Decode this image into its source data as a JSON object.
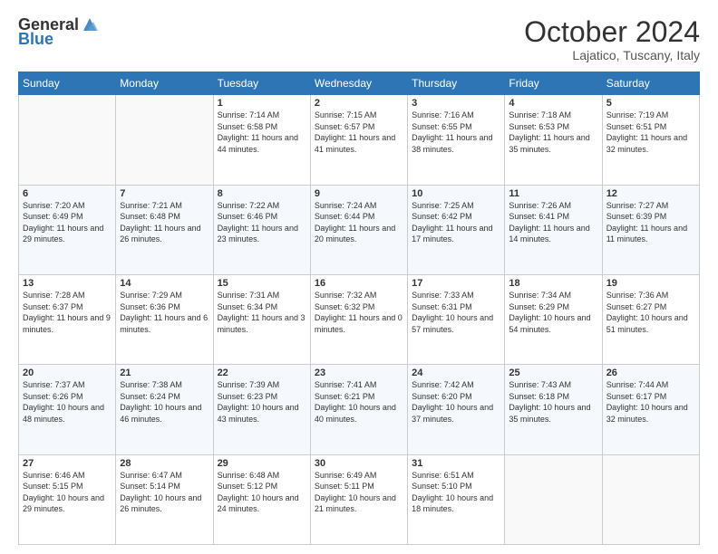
{
  "header": {
    "logo_text_general": "General",
    "logo_text_blue": "Blue",
    "month": "October 2024",
    "location": "Lajatico, Tuscany, Italy"
  },
  "days_of_week": [
    "Sunday",
    "Monday",
    "Tuesday",
    "Wednesday",
    "Thursday",
    "Friday",
    "Saturday"
  ],
  "weeks": [
    [
      {
        "day": "",
        "info": ""
      },
      {
        "day": "",
        "info": ""
      },
      {
        "day": "1",
        "info": "Sunrise: 7:14 AM\nSunset: 6:58 PM\nDaylight: 11 hours and 44 minutes."
      },
      {
        "day": "2",
        "info": "Sunrise: 7:15 AM\nSunset: 6:57 PM\nDaylight: 11 hours and 41 minutes."
      },
      {
        "day": "3",
        "info": "Sunrise: 7:16 AM\nSunset: 6:55 PM\nDaylight: 11 hours and 38 minutes."
      },
      {
        "day": "4",
        "info": "Sunrise: 7:18 AM\nSunset: 6:53 PM\nDaylight: 11 hours and 35 minutes."
      },
      {
        "day": "5",
        "info": "Sunrise: 7:19 AM\nSunset: 6:51 PM\nDaylight: 11 hours and 32 minutes."
      }
    ],
    [
      {
        "day": "6",
        "info": "Sunrise: 7:20 AM\nSunset: 6:49 PM\nDaylight: 11 hours and 29 minutes."
      },
      {
        "day": "7",
        "info": "Sunrise: 7:21 AM\nSunset: 6:48 PM\nDaylight: 11 hours and 26 minutes."
      },
      {
        "day": "8",
        "info": "Sunrise: 7:22 AM\nSunset: 6:46 PM\nDaylight: 11 hours and 23 minutes."
      },
      {
        "day": "9",
        "info": "Sunrise: 7:24 AM\nSunset: 6:44 PM\nDaylight: 11 hours and 20 minutes."
      },
      {
        "day": "10",
        "info": "Sunrise: 7:25 AM\nSunset: 6:42 PM\nDaylight: 11 hours and 17 minutes."
      },
      {
        "day": "11",
        "info": "Sunrise: 7:26 AM\nSunset: 6:41 PM\nDaylight: 11 hours and 14 minutes."
      },
      {
        "day": "12",
        "info": "Sunrise: 7:27 AM\nSunset: 6:39 PM\nDaylight: 11 hours and 11 minutes."
      }
    ],
    [
      {
        "day": "13",
        "info": "Sunrise: 7:28 AM\nSunset: 6:37 PM\nDaylight: 11 hours and 9 minutes."
      },
      {
        "day": "14",
        "info": "Sunrise: 7:29 AM\nSunset: 6:36 PM\nDaylight: 11 hours and 6 minutes."
      },
      {
        "day": "15",
        "info": "Sunrise: 7:31 AM\nSunset: 6:34 PM\nDaylight: 11 hours and 3 minutes."
      },
      {
        "day": "16",
        "info": "Sunrise: 7:32 AM\nSunset: 6:32 PM\nDaylight: 11 hours and 0 minutes."
      },
      {
        "day": "17",
        "info": "Sunrise: 7:33 AM\nSunset: 6:31 PM\nDaylight: 10 hours and 57 minutes."
      },
      {
        "day": "18",
        "info": "Sunrise: 7:34 AM\nSunset: 6:29 PM\nDaylight: 10 hours and 54 minutes."
      },
      {
        "day": "19",
        "info": "Sunrise: 7:36 AM\nSunset: 6:27 PM\nDaylight: 10 hours and 51 minutes."
      }
    ],
    [
      {
        "day": "20",
        "info": "Sunrise: 7:37 AM\nSunset: 6:26 PM\nDaylight: 10 hours and 48 minutes."
      },
      {
        "day": "21",
        "info": "Sunrise: 7:38 AM\nSunset: 6:24 PM\nDaylight: 10 hours and 46 minutes."
      },
      {
        "day": "22",
        "info": "Sunrise: 7:39 AM\nSunset: 6:23 PM\nDaylight: 10 hours and 43 minutes."
      },
      {
        "day": "23",
        "info": "Sunrise: 7:41 AM\nSunset: 6:21 PM\nDaylight: 10 hours and 40 minutes."
      },
      {
        "day": "24",
        "info": "Sunrise: 7:42 AM\nSunset: 6:20 PM\nDaylight: 10 hours and 37 minutes."
      },
      {
        "day": "25",
        "info": "Sunrise: 7:43 AM\nSunset: 6:18 PM\nDaylight: 10 hours and 35 minutes."
      },
      {
        "day": "26",
        "info": "Sunrise: 7:44 AM\nSunset: 6:17 PM\nDaylight: 10 hours and 32 minutes."
      }
    ],
    [
      {
        "day": "27",
        "info": "Sunrise: 6:46 AM\nSunset: 5:15 PM\nDaylight: 10 hours and 29 minutes."
      },
      {
        "day": "28",
        "info": "Sunrise: 6:47 AM\nSunset: 5:14 PM\nDaylight: 10 hours and 26 minutes."
      },
      {
        "day": "29",
        "info": "Sunrise: 6:48 AM\nSunset: 5:12 PM\nDaylight: 10 hours and 24 minutes."
      },
      {
        "day": "30",
        "info": "Sunrise: 6:49 AM\nSunset: 5:11 PM\nDaylight: 10 hours and 21 minutes."
      },
      {
        "day": "31",
        "info": "Sunrise: 6:51 AM\nSunset: 5:10 PM\nDaylight: 10 hours and 18 minutes."
      },
      {
        "day": "",
        "info": ""
      },
      {
        "day": "",
        "info": ""
      }
    ]
  ]
}
